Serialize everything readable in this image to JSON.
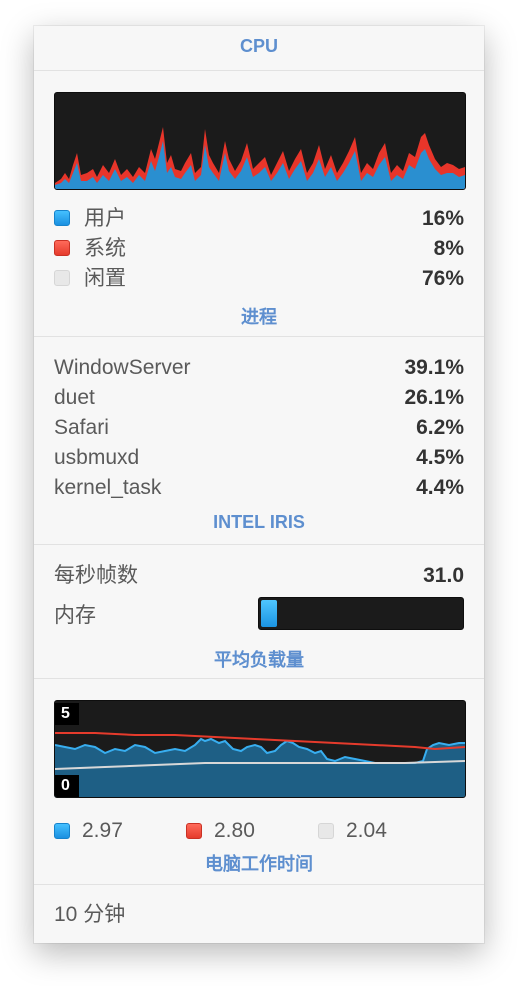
{
  "cpu": {
    "header": "CPU",
    "legend": [
      {
        "label": "用户",
        "value": "16%",
        "color": "#2aa8f2"
      },
      {
        "label": "系统",
        "value": "8%",
        "color": "#f04a3c"
      },
      {
        "label": "闲置",
        "value": "76%",
        "color": "#e8e8e8"
      }
    ]
  },
  "processes": {
    "header": "进程",
    "items": [
      {
        "name": "WindowServer",
        "value": "39.1%"
      },
      {
        "name": "duet",
        "value": "26.1%"
      },
      {
        "name": "Safari",
        "value": "6.2%"
      },
      {
        "name": "usbmuxd",
        "value": "4.5%"
      },
      {
        "name": "kernel_task",
        "value": "4.4%"
      }
    ]
  },
  "gpu": {
    "header": "INTEL IRIS",
    "fps_label": "每秒帧数",
    "fps_value": "31.0",
    "memory_label": "内存",
    "memory_fraction": 0.08
  },
  "load": {
    "header": "平均负载量",
    "scale_max": "5",
    "scale_min": "0",
    "values": [
      {
        "value": "2.97",
        "color": "#2aa8f2"
      },
      {
        "value": "2.80",
        "color": "#f04a3c"
      },
      {
        "value": "2.04",
        "color": "#e8e8e8"
      }
    ]
  },
  "uptime": {
    "header": "电脑工作时间",
    "value": "10 分钟"
  }
}
